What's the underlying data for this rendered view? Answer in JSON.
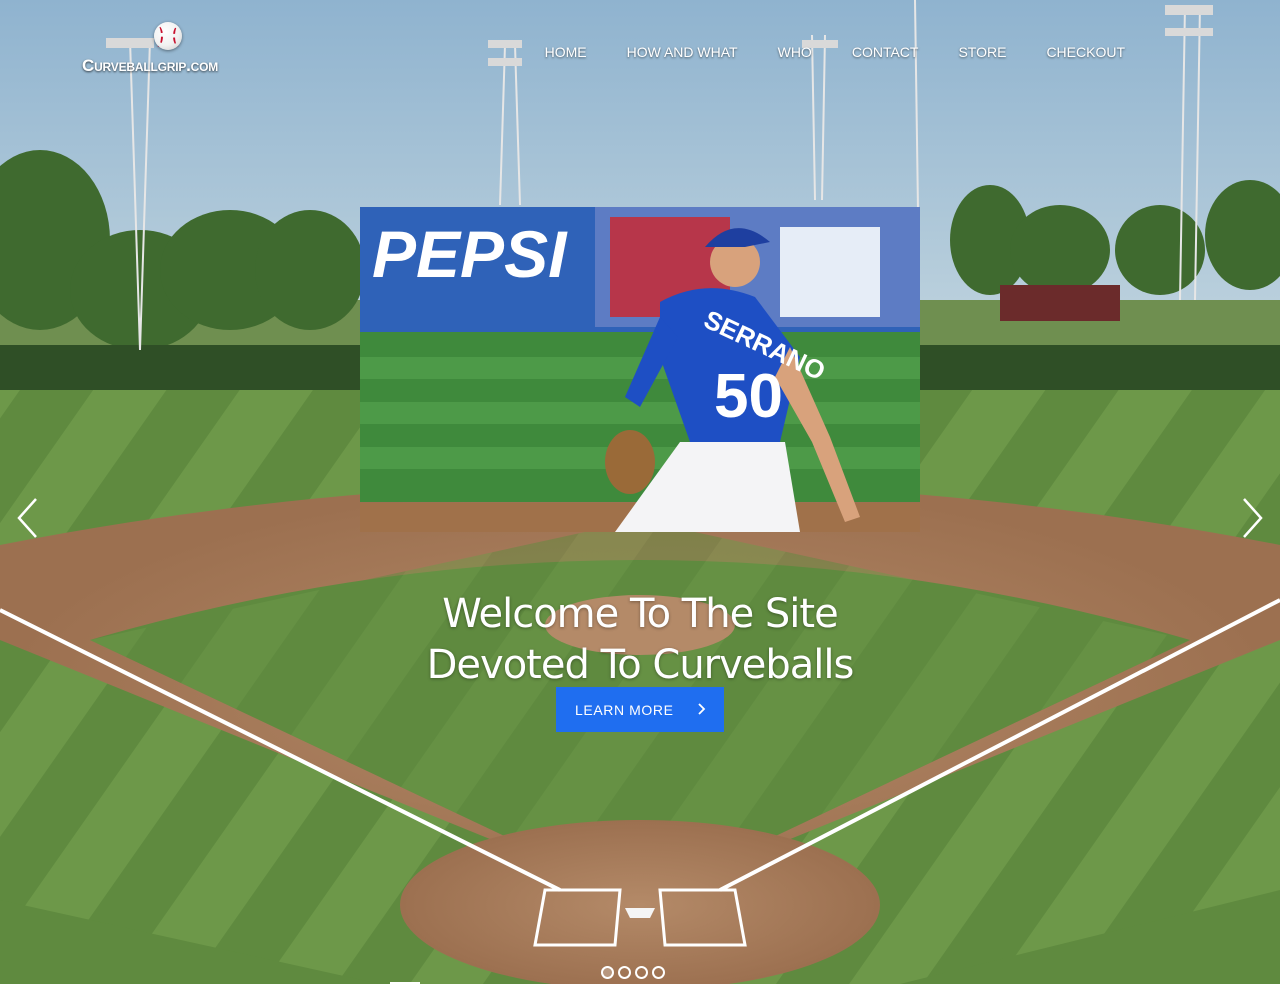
{
  "site": {
    "logo_text": "Curveballgrip.com"
  },
  "nav": {
    "items": [
      {
        "label": "HOME"
      },
      {
        "label": "HOW AND WHAT"
      },
      {
        "label": "WHO"
      },
      {
        "label": "CONTACT"
      },
      {
        "label": "STORE"
      },
      {
        "label": "CHECKOUT"
      }
    ]
  },
  "hero": {
    "headline_line1": "Welcome To The Site",
    "headline_line2": "Devoted To Curveballs",
    "cta_label": "LEARN MORE",
    "slide_photo": {
      "banner_text": "PEPSI",
      "player_name": "SERRANO",
      "player_number": "50"
    },
    "slider": {
      "slide_count": 4,
      "active_index": 0,
      "prev_icon": "chevron-left-icon",
      "next_icon": "chevron-right-icon"
    }
  },
  "colors": {
    "cta_blue": "#1f6ef0",
    "nav_text": "#ffffff",
    "jersey_blue": "#1e4fc4"
  }
}
